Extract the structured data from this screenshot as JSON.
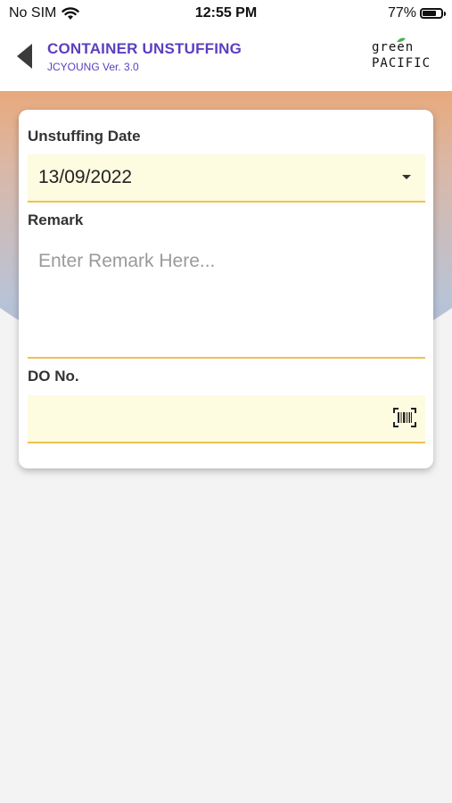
{
  "status_bar": {
    "carrier": "No SIM",
    "time": "12:55 PM",
    "battery_percent": "77%",
    "battery_level": 0.77
  },
  "header": {
    "title": "CONTAINER UNSTUFFING",
    "subtitle": "JCYOUNG Ver. 3.0",
    "logo_line1": "green",
    "logo_line2": "PACIFIC",
    "accent_color": "#5b3fc0"
  },
  "form": {
    "date_label": "Unstuffing Date",
    "date_value": "13/09/2022",
    "remark_label": "Remark",
    "remark_placeholder": "Enter Remark Here...",
    "remark_value": "",
    "do_label": "DO No.",
    "do_value": ""
  },
  "icons": {
    "back": "back-arrow-icon",
    "dropdown": "chevron-down-icon",
    "scan": "barcode-scan-icon"
  },
  "colors": {
    "field_bg": "#fdfbe0",
    "field_underline": "#f0c050",
    "banner_top": "#f28a3a",
    "banner_bottom": "#aeb9d1"
  }
}
